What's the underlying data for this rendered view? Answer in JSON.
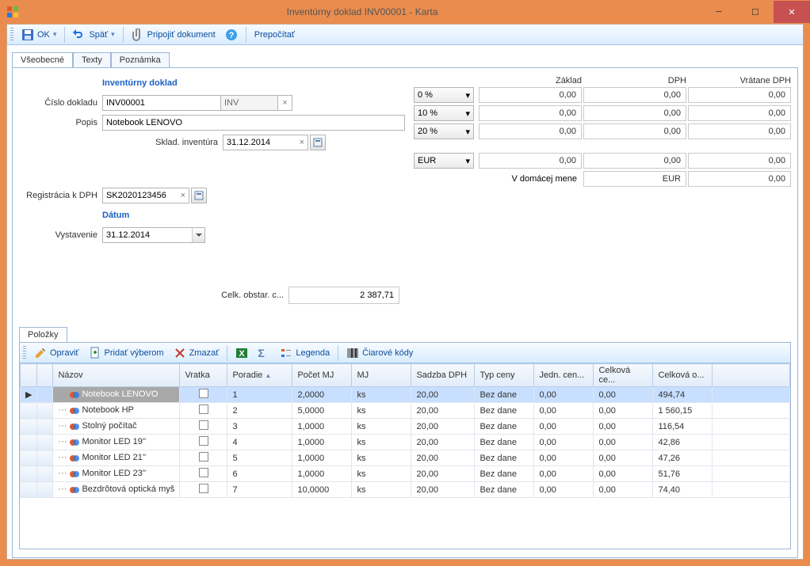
{
  "window": {
    "title": "Inventúrny doklad INV00001 - Karta"
  },
  "toolbar": {
    "ok": "OK",
    "back": "Späť",
    "attach": "Pripojiť dokument",
    "recalc": "Prepočítať"
  },
  "tabs": {
    "t0": "Všeobecné",
    "t1": "Texty",
    "t2": "Poznámka"
  },
  "form": {
    "doc_header": "Inventúrny doklad",
    "doc_number_lbl": "Číslo dokladu",
    "doc_number": "INV00001",
    "doc_series": "INV",
    "desc_lbl": "Popis",
    "desc": "Notebook LENOVO",
    "stock_inv_lbl": "Sklad. inventúra",
    "stock_inv_date": "31.12.2014",
    "vat_reg_lbl": "Registrácia k DPH",
    "vat_reg": "SK2020123456",
    "date_header": "Dátum",
    "issue_lbl": "Vystavenie",
    "issue_date_prefix": "31.12.",
    "issue_date_sel": "2014",
    "total_lbl": "Celk. obstar. c...",
    "total_val": "2 387,71"
  },
  "tax": {
    "hdr_base": "Základ",
    "hdr_vat": "DPH",
    "hdr_incl": "Vrátane DPH",
    "rates": [
      "0 %",
      "10 %",
      "20 %"
    ],
    "zero": "0,00",
    "currency": "EUR",
    "domestic_lbl": "V domácej mene",
    "domestic_cur": "EUR"
  },
  "items_tab": "Položky",
  "items_tb": {
    "edit": "Opraviť",
    "add": "Pridať výberom",
    "del": "Zmazať",
    "legend": "Legenda",
    "barcode": "Čiarové kódy"
  },
  "cols": {
    "name": "Názov",
    "vratka": "Vratka",
    "order": "Poradie",
    "qty": "Počet MJ",
    "unit": "MJ",
    "vat": "Sadzba DPH",
    "pricetype": "Typ ceny",
    "unitprice": "Jedn. cen...",
    "total": "Celková ce...",
    "totalcost": "Celková o..."
  },
  "rows": [
    {
      "name": "Notebook LENOVO",
      "order": "1",
      "qty": "2,0000",
      "unit": "ks",
      "vat": "20,00",
      "pt": "Bez dane",
      "up": "0,00",
      "tc": "0,00",
      "cost": "494,74"
    },
    {
      "name": "Notebook HP",
      "order": "2",
      "qty": "5,0000",
      "unit": "ks",
      "vat": "20,00",
      "pt": "Bez dane",
      "up": "0,00",
      "tc": "0,00",
      "cost": "1 560,15"
    },
    {
      "name": "Stolný počítač",
      "order": "3",
      "qty": "1,0000",
      "unit": "ks",
      "vat": "20,00",
      "pt": "Bez dane",
      "up": "0,00",
      "tc": "0,00",
      "cost": "116,54"
    },
    {
      "name": "Monitor LED 19''",
      "order": "4",
      "qty": "1,0000",
      "unit": "ks",
      "vat": "20,00",
      "pt": "Bez dane",
      "up": "0,00",
      "tc": "0,00",
      "cost": "42,86"
    },
    {
      "name": "Monitor LED 21''",
      "order": "5",
      "qty": "1,0000",
      "unit": "ks",
      "vat": "20,00",
      "pt": "Bez dane",
      "up": "0,00",
      "tc": "0,00",
      "cost": "47,26"
    },
    {
      "name": "Monitor LED 23''",
      "order": "6",
      "qty": "1,0000",
      "unit": "ks",
      "vat": "20,00",
      "pt": "Bez dane",
      "up": "0,00",
      "tc": "0,00",
      "cost": "51,76"
    },
    {
      "name": "Bezdrôtová optická myš",
      "order": "7",
      "qty": "10,0000",
      "unit": "ks",
      "vat": "20,00",
      "pt": "Bez dane",
      "up": "0,00",
      "tc": "0,00",
      "cost": "74,40"
    }
  ]
}
